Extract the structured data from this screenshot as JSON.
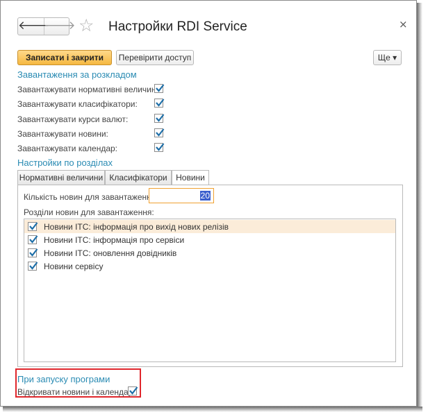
{
  "window": {
    "title": "Настройки RDI Service",
    "close_glyph": "×",
    "back_glyph": "🡐",
    "forward_glyph": "🡒",
    "star_glyph": "☆"
  },
  "toolbar": {
    "save_close_label": "Записати і закрити",
    "check_access_label": "Перевірити доступ",
    "more_label": "Ще ▾"
  },
  "schedule": {
    "heading": "Завантаження за розкладом",
    "items": [
      {
        "label": "Завантажувати нормативні величини:",
        "checked": true
      },
      {
        "label": "Завантажувати класифікатори:",
        "checked": true
      },
      {
        "label": "Завантажувати курси валют:",
        "checked": true
      },
      {
        "label": "Завантажувати новини:",
        "checked": true
      },
      {
        "label": "Завантажувати календар:",
        "checked": true
      }
    ]
  },
  "sections": {
    "heading": "Настройки по розділах",
    "tabs": [
      {
        "label": "Нормативні величини",
        "active": false
      },
      {
        "label": "Класифікатори",
        "active": false
      },
      {
        "label": "Новини",
        "active": true
      }
    ],
    "news": {
      "count_label": "Кількість новин для завантаження:",
      "count_value": "20",
      "sections_label": "Розділи новин для завантаження:",
      "list": [
        {
          "label": "Новини ІТС: інформація про вихід нових релізів",
          "checked": true,
          "selected": true
        },
        {
          "label": "Новини ІТС: інформація про сервіси",
          "checked": true,
          "selected": false
        },
        {
          "label": "Новини ІТС: оновлення довідників",
          "checked": true,
          "selected": false
        },
        {
          "label": "Новини сервісу",
          "checked": true,
          "selected": false
        }
      ]
    }
  },
  "startup": {
    "heading": "При запуску програми",
    "open_label": "Відкривати новини і календар:",
    "open_checked": true
  },
  "colors": {
    "accent_heading": "#2a8bb3",
    "primary_button": "#f5b841",
    "selected_row": "#fbecd9",
    "highlight_box": "#e0262b",
    "focus_border": "#f0a030"
  }
}
